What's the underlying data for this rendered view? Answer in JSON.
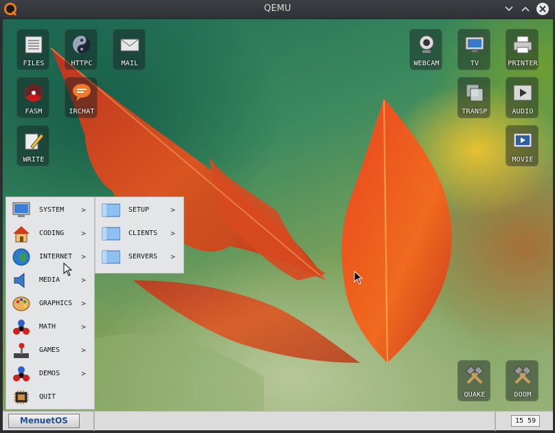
{
  "window": {
    "title": "QEMU"
  },
  "desktop_icons": [
    {
      "label": "FILES",
      "icon": "files-icon"
    },
    {
      "label": "HTTPC",
      "icon": "httpc-icon"
    },
    {
      "label": "MAIL",
      "icon": "mail-icon"
    },
    {
      "label": "FASM",
      "icon": "fasm-icon"
    },
    {
      "label": "IRCHAT",
      "icon": "irchat-icon"
    },
    {
      "label": "WRITE",
      "icon": "write-icon"
    },
    {
      "label": "WEBCAM",
      "icon": "webcam-icon"
    },
    {
      "label": "TV",
      "icon": "tv-icon"
    },
    {
      "label": "PRINTER",
      "icon": "printer-icon"
    },
    {
      "label": "TRANSP",
      "icon": "transparency-icon"
    },
    {
      "label": "AUDIO",
      "icon": "audio-icon"
    },
    {
      "label": "MOVIE",
      "icon": "movie-icon"
    },
    {
      "label": "QUAKE",
      "icon": "quake-icon"
    },
    {
      "label": "DOOM",
      "icon": "doom-icon"
    }
  ],
  "start_menu": {
    "items": [
      {
        "label": "SYSTEM",
        "arrow": ">"
      },
      {
        "label": "CODING",
        "arrow": ">"
      },
      {
        "label": "INTERNET",
        "arrow": ">"
      },
      {
        "label": "MEDIA",
        "arrow": ">"
      },
      {
        "label": "GRAPHICS",
        "arrow": ">"
      },
      {
        "label": "MATH",
        "arrow": ">"
      },
      {
        "label": "GAMES",
        "arrow": ">"
      },
      {
        "label": "DEMOS",
        "arrow": ">"
      },
      {
        "label": "QUIT",
        "arrow": ""
      }
    ]
  },
  "internet_submenu": {
    "items": [
      {
        "label": "SETUP",
        "arrow": ">"
      },
      {
        "label": "CLIENTS",
        "arrow": ">"
      },
      {
        "label": "SERVERS",
        "arrow": ">"
      }
    ]
  },
  "taskbar": {
    "start_label": "MenuetOS",
    "clock": "15 59"
  },
  "colors": {
    "accent": "#1f4f93",
    "menu_bg": "#e4e5e6",
    "titlebar": "#2f3236"
  }
}
